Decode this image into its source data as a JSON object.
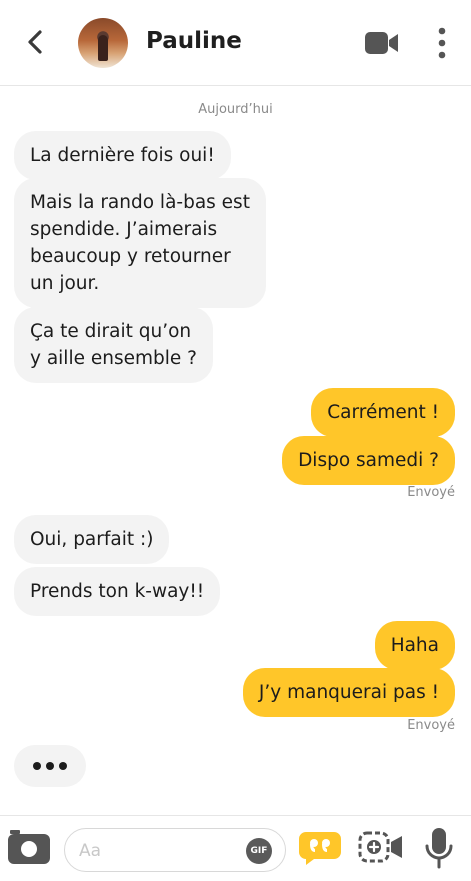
{
  "header": {
    "contact_name": "Pauline",
    "back_icon": "chevron-left-icon",
    "video_icon": "video-camera-icon",
    "more_icon": "vertical-dots-icon"
  },
  "conversation": {
    "date_label": "Aujourd’hui",
    "messages": [
      {
        "side": "in",
        "text": "La dernière fois oui!"
      },
      {
        "side": "in",
        "text": "Mais la rando là-bas est\nspendide. J’aimerais\nbeaucoup y retourner\nun jour."
      },
      {
        "side": "in",
        "text": "Ça te dirait qu’on\ny aille ensemble ?"
      },
      {
        "side": "out",
        "text": "Carrément !"
      },
      {
        "side": "out",
        "text": "Dispo samedi ?"
      },
      {
        "side": "in",
        "text": "Oui, parfait :)"
      },
      {
        "side": "in",
        "text": "Prends ton k-way!!"
      },
      {
        "side": "out",
        "text": "Haha"
      },
      {
        "side": "out",
        "text": "J’y manquerai pas !"
      }
    ],
    "status_1": "Envoyé",
    "status_2": "Envoyé",
    "typing_indicator": "typing-dots"
  },
  "composer": {
    "placeholder": "Aa",
    "gif_label": "GIF",
    "camera_icon": "camera-icon",
    "quote_icon": "quote-bubble-icon",
    "gallery_icon": "photo-video-icon",
    "mic_icon": "microphone-icon"
  },
  "colors": {
    "accent_yellow": "#ffc629",
    "incoming_bubble": "#f3f3f3",
    "text_dark": "#1c1c1c",
    "muted_text": "#8a8a8a"
  }
}
